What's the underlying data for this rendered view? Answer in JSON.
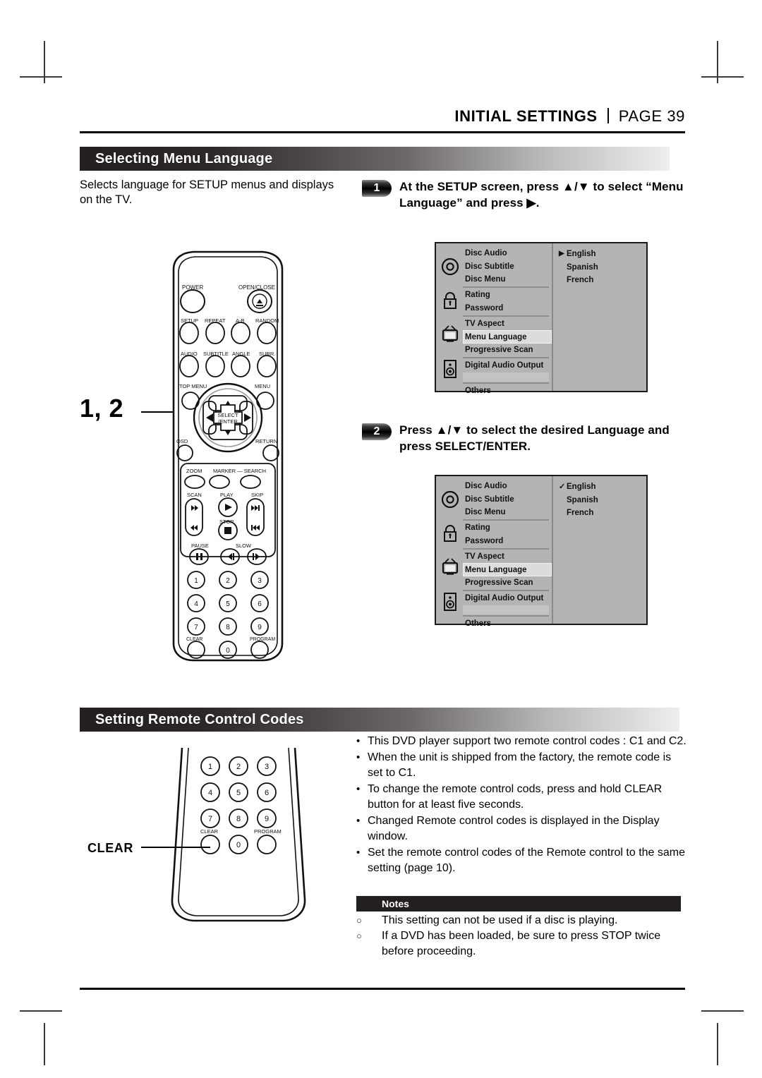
{
  "header": {
    "title": "INITIAL SETTINGS",
    "page": "PAGE 39"
  },
  "section1": {
    "title": "Selecting Menu Language",
    "intro": "Selects language for SETUP menus and displays on the TV.",
    "callout": "1, 2",
    "steps": [
      {
        "number": "1",
        "text": "At the SETUP screen, press ▲/▼ to select “Menu Language” and press ▶."
      },
      {
        "number": "2",
        "text": "Press ▲/▼ to select the desired Language and press SELECT/ENTER."
      }
    ],
    "setup_screen_1": {
      "menu_items": [
        "Disc Audio",
        "Disc Subtitle",
        "Disc Menu",
        "Rating",
        "Password",
        "TV Aspect",
        "Menu Language",
        "Progressive Scan",
        "Digital Audio Output",
        "",
        "Others"
      ],
      "highlighted": "Menu Language",
      "icons": [
        "disc-icon",
        "lock-icon",
        "tv-icon",
        "speaker-icon"
      ],
      "languages": [
        "English",
        "Spanish",
        "French"
      ],
      "marker": "▶",
      "marked_language": "English"
    },
    "setup_screen_2": {
      "menu_items": [
        "Disc Audio",
        "Disc Subtitle",
        "Disc Menu",
        "Rating",
        "Password",
        "TV Aspect",
        "Menu Language",
        "Progressive Scan",
        "Digital Audio Output",
        "",
        "Others"
      ],
      "highlighted": "Menu Language",
      "icons": [
        "disc-icon",
        "lock-icon",
        "tv-icon",
        "speaker-icon"
      ],
      "languages": [
        "English",
        "Spanish",
        "French"
      ],
      "marker": "✓",
      "marked_language": "English"
    }
  },
  "section2": {
    "title": "Setting Remote Control Codes",
    "callout": "CLEAR",
    "bullets": [
      "This DVD player support two remote control codes : C1 and C2.",
      "When the unit is shipped from the factory, the remote code is set to C1.",
      "To change the remote control cods, press and hold CLEAR button for at least five seconds.",
      "Changed Remote control codes is displayed in the Display window.",
      "Set the remote control codes of the Remote control to the same setting (page 10)."
    ],
    "notes_title": "Notes",
    "notes": [
      "This setting can not be used if a disc is playing.",
      "If a DVD has been loaded, be sure to press STOP twice before proceeding."
    ],
    "bullet_mark": "•",
    "note_mark": "○"
  },
  "remote": {
    "top_labels": {
      "power": "POWER",
      "open_close": "OPEN/CLOSE",
      "setup": "SETUP",
      "repeat": "REPEAT",
      "ab": "A-B",
      "random": "RANDOM",
      "audio": "AUDIO",
      "subtitle": "SUBTITLE",
      "angle": "ANGLE",
      "surr": "SURR.",
      "top_menu": "TOP MENU",
      "menu": "MENU",
      "select_enter_1": "SELECT",
      "select_enter_2": "/ENTER",
      "osd": "OSD",
      "return": "RETURN",
      "zoom": "ZOOM",
      "marker_search": "MARKER — SEARCH",
      "scan": "SCAN",
      "play": "PLAY",
      "skip": "SKIP",
      "stop": "STOP",
      "pause": "PAUSE",
      "slow": "SLOW",
      "clear": "CLEAR",
      "program": "PROGRAM"
    },
    "keypad": [
      "1",
      "2",
      "3",
      "4",
      "5",
      "6",
      "7",
      "8",
      "9",
      "0"
    ],
    "keypad_clear": "CLEAR",
    "keypad_program": "PROGRAM"
  },
  "colors": {
    "bar_dark": "#231f20",
    "osd_bg": "#b4b4b4",
    "osd_highlight": "#dcdcdc",
    "rule": "#000000"
  }
}
